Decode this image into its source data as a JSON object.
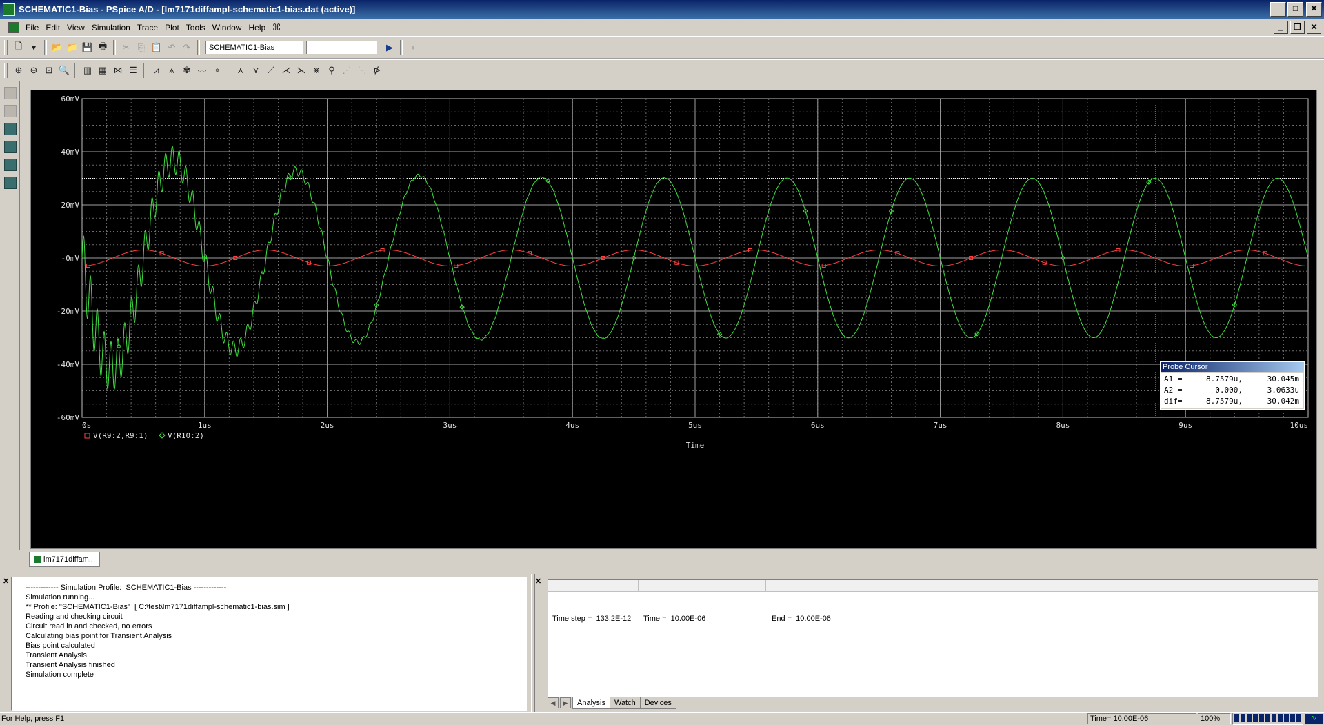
{
  "window": {
    "title": "SCHEMATIC1-Bias - PSpice A/D  - [lm7171diffampl-schematic1-bias.dat (active)]",
    "buttons": {
      "minimize": "_",
      "maximize": "□",
      "close": "✕"
    }
  },
  "menu": {
    "items": [
      "File",
      "Edit",
      "View",
      "Simulation",
      "Trace",
      "Plot",
      "Tools",
      "Window",
      "Help"
    ],
    "mdi_buttons": {
      "minimize": "_",
      "restore": "❐",
      "close": "✕"
    }
  },
  "toolbar": {
    "profile_combo": "SCHEMATIC1-Bias",
    "second_combo": ""
  },
  "chart_data": {
    "type": "line",
    "ylim": [
      -60,
      60
    ],
    "xlim": [
      0,
      10
    ],
    "y_ticks": [
      60,
      40,
      20,
      0,
      -20,
      -40,
      -60
    ],
    "y_tick_labels": [
      "60mV",
      "40mV",
      "20mV",
      "-0mV",
      "-20mV",
      "-40mV",
      "-60mV"
    ],
    "x_ticks": [
      0,
      1,
      2,
      3,
      4,
      5,
      6,
      7,
      8,
      9,
      10
    ],
    "x_tick_labels": [
      "0s",
      "1us",
      "2us",
      "3us",
      "4us",
      "5us",
      "6us",
      "7us",
      "8us",
      "9us",
      "10us"
    ],
    "xlabel": "Time",
    "grid": true,
    "series": [
      {
        "name": "V(R9:2,R9:1)",
        "color": "#ff4040",
        "marker": "square",
        "amplitude_mV": 3,
        "period_us": 1.0
      },
      {
        "name": "V(R10:2)",
        "color": "#40e040",
        "marker": "diamond",
        "amplitude_mV": 30,
        "period_us": 1.0,
        "start_peak_mV": 42,
        "start_trough_mV": -50
      }
    ],
    "cursor": {
      "x1_us": 8.7579,
      "x2_us": 0.0,
      "y_level_mV": 30
    }
  },
  "probe_cursor": {
    "title": "Probe Cursor",
    "rows": [
      {
        "label": "A1 =",
        "x": "8.7579u,",
        "y": "30.045m"
      },
      {
        "label": "A2 =",
        "x": "0.000,",
        "y": "3.0633u"
      },
      {
        "label": "dif=",
        "x": "8.7579u,",
        "y": "30.042m"
      }
    ]
  },
  "doc_tab": "lm7171diffam...",
  "output": {
    "lines": [
      "------------- Simulation Profile:  SCHEMATIC1-Bias -------------",
      "Simulation running...",
      "** Profile: \"SCHEMATIC1-Bias\"  [ C:\\test\\lm7171diffampl-schematic1-bias.sim ]",
      "Reading and checking circuit",
      "Circuit read in and checked, no errors",
      "Calculating bias point for Transient Analysis",
      "Bias point calculated",
      "Transient Analysis",
      "Transient Analysis finished",
      "Simulation complete"
    ]
  },
  "analysis": {
    "time_step": "Time step =  133.2E-12",
    "time": "Time =  10.00E-06",
    "end": "End =  10.00E-06"
  },
  "tabs": [
    "Analysis",
    "Watch",
    "Devices"
  ],
  "status": {
    "help": "For Help, press F1",
    "time": "Time= 10.00E-06",
    "zoom": "100%"
  }
}
